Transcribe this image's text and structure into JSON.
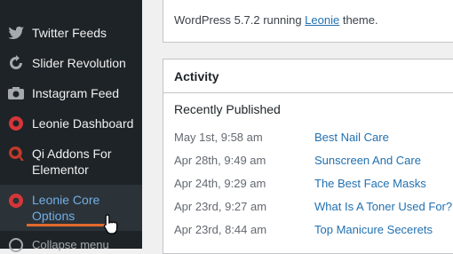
{
  "sidebar": {
    "items": [
      {
        "label": "Twitter Feeds",
        "icon": "twitter-icon"
      },
      {
        "label": "Slider Revolution",
        "icon": "slider-revolution-icon"
      },
      {
        "label": "Instagram Feed",
        "icon": "camera-icon"
      },
      {
        "label": "Leonie Dashboard",
        "icon": "leonie-icon"
      },
      {
        "label": "Qi Addons For Elementor",
        "icon": "qi-icon"
      },
      {
        "label": "Leonie Core Options",
        "icon": "leonie-icon",
        "active": true
      }
    ],
    "collapse_label": "Collapse menu",
    "colors": {
      "background": "#1d2327",
      "active_text": "#72aee6",
      "text": "#f0f0f1",
      "underline": "#e26a2c"
    }
  },
  "footer_info": {
    "prefix": "WordPress 5.7.2 running ",
    "theme_link": "Leonie",
    "suffix": " theme."
  },
  "activity": {
    "title": "Activity",
    "recent_heading": "Recently Published",
    "posts": [
      {
        "date": "May 1st, 9:58 am",
        "title": "Best Nail Care"
      },
      {
        "date": "Apr 28th, 9:49 am",
        "title": "Sunscreen And Care"
      },
      {
        "date": "Apr 24th, 9:29 am",
        "title": "The Best Face Masks"
      },
      {
        "date": "Apr 23rd, 9:27 am",
        "title": "What Is A Toner Used For?"
      },
      {
        "date": "Apr 23rd, 8:44 am",
        "title": "Top Manicure Secerets"
      }
    ]
  },
  "colors": {
    "link": "#2271b1",
    "muted": "#646970"
  }
}
